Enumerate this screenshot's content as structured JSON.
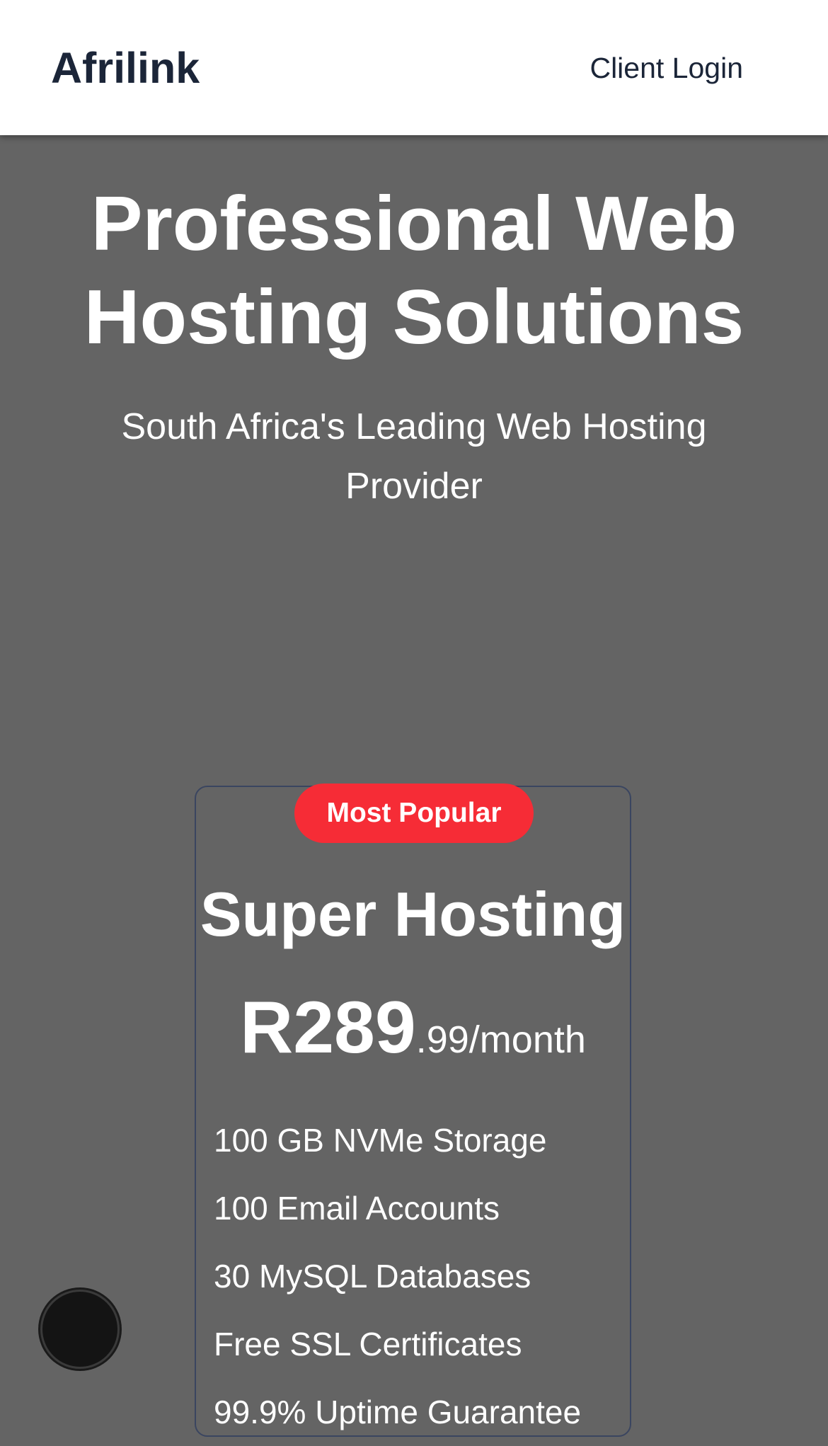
{
  "header": {
    "logo": "Afrilink",
    "login_label": "Client Login"
  },
  "hero": {
    "title": "Professional Web Hosting Solutions",
    "subtitle": "South Africa's Leading Web Hosting Provider"
  },
  "plan": {
    "badge": "Most Popular",
    "name": "Super Hosting",
    "price_main": "R289",
    "price_suffix": ".99/month",
    "features": [
      "100 GB NVMe Storage",
      "100 Email Accounts",
      "30 MySQL Databases",
      "Free SSL Certificates",
      "99.9% Uptime Guarantee"
    ]
  },
  "colors": {
    "header_bg": "#ffffff",
    "page_bg": "#646464",
    "brand_text": "#1b2538",
    "badge_bg": "#f62c36",
    "card_border": "#3a4560",
    "chat_button": "#141414"
  },
  "icons": {
    "chat_button": "chat-widget-icon"
  }
}
